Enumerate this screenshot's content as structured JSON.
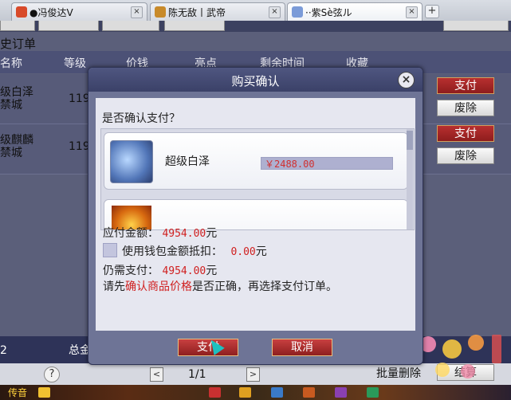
{
  "browser_tabs": [
    {
      "title": "●冯俊达ᐯ",
      "close": "×",
      "favicon_color": "#d84a2a"
    },
    {
      "title": "陈无敌丨武帝",
      "close": "×",
      "favicon_color": "#c88a2a"
    },
    {
      "title": "··紫Sè弦ル",
      "close": "×",
      "favicon_color": "#7b9bd8"
    }
  ],
  "new_tab": "+",
  "background": {
    "orders_label": "史订单",
    "headers": [
      "名称",
      "等级",
      "价钱",
      "亮点",
      "剩余时间",
      "收藏"
    ],
    "rows": [
      {
        "name": "级白泽\n禁城",
        "level": "119",
        "pay": "支付",
        "delete": "废除"
      },
      {
        "name": "级麒麟\n禁城",
        "level": "119",
        "pay": "支付",
        "delete": "废除"
      }
    ],
    "footer_num": "2",
    "footer_total": "总金",
    "help": "?",
    "pager": {
      "prev": "<",
      "page": "1/1",
      "next": ">"
    },
    "batch_delete": "批量删除",
    "checkout": "结算",
    "taskbar_label": "传音"
  },
  "dialog": {
    "title": "购买确认",
    "close": "×",
    "question": "是否确认支付？",
    "items": [
      {
        "name": "超级白泽",
        "price": "￥2488.00"
      },
      {
        "name": "",
        "price": ""
      }
    ],
    "payable_label": "应付金额：",
    "payable_value": "4954.00",
    "payable_unit": "元",
    "wallet_label": "使用钱包金额抵扣：",
    "wallet_value": "0.00",
    "wallet_unit": "元",
    "still_label": "仍需支付：",
    "still_value": "4954.00",
    "still_unit": "元",
    "note_pre": "请先",
    "note_highlight": "确认商品价格",
    "note_post": "是否正确，再选择支付订单。",
    "confirm_button": "支付",
    "cancel_button": "取消"
  },
  "colors": {
    "accent_red": "#d02020",
    "dialog_bg": "#6e7496"
  }
}
